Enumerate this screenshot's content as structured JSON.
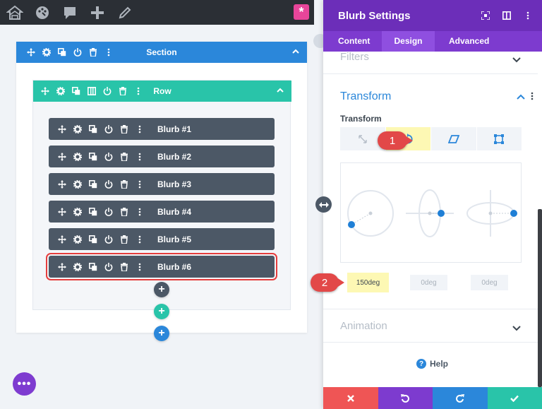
{
  "toolbar": {
    "icons": [
      "wireframe-icon",
      "palette-icon",
      "comment-icon",
      "plus-icon",
      "pencil-icon"
    ],
    "brand_icon": "star-icon",
    "brand_glyph": "*"
  },
  "builder": {
    "section": {
      "title": "Section"
    },
    "row": {
      "title": "Row"
    },
    "modules": [
      {
        "title": "Blurb #1"
      },
      {
        "title": "Blurb #2"
      },
      {
        "title": "Blurb #3"
      },
      {
        "title": "Blurb #4"
      },
      {
        "title": "Blurb #5"
      },
      {
        "title": "Blurb #6",
        "highlighted": true
      }
    ],
    "add_glyph": "+",
    "fab_glyph": "•••"
  },
  "panel": {
    "title": "Blurb Settings",
    "tabs": [
      {
        "label": "Content"
      },
      {
        "label": "Design",
        "active": true
      },
      {
        "label": "Advanced"
      }
    ],
    "filters": {
      "title": "Filters"
    },
    "transform": {
      "title": "Transform",
      "label": "Transform",
      "subtabs": [
        "scale-icon",
        "rotate-icon",
        "skew-icon",
        "origin-icon"
      ],
      "active_subtab": "rotate-icon",
      "inputs": [
        {
          "value": "150deg",
          "active": true
        },
        {
          "value": "0deg"
        },
        {
          "value": "0deg"
        }
      ]
    },
    "animation": {
      "title": "Animation"
    },
    "help": {
      "label": "Help",
      "glyph": "?"
    },
    "footer_icons": [
      "close-icon",
      "undo-icon",
      "redo-icon",
      "check-icon"
    ]
  },
  "callouts": [
    {
      "label": "1"
    },
    {
      "label": "2"
    }
  ],
  "colors": {
    "section": "#2b87da",
    "row": "#29c4a9",
    "module": "#4c5866",
    "panel_header": "#6c2eb9",
    "panel_tabs": "#7d3bcf",
    "highlight": "#fdf8b4",
    "callout": "#e24848",
    "footer": [
      "#ef5555",
      "#7d3bcf",
      "#2b87da",
      "#29c4a9"
    ]
  }
}
